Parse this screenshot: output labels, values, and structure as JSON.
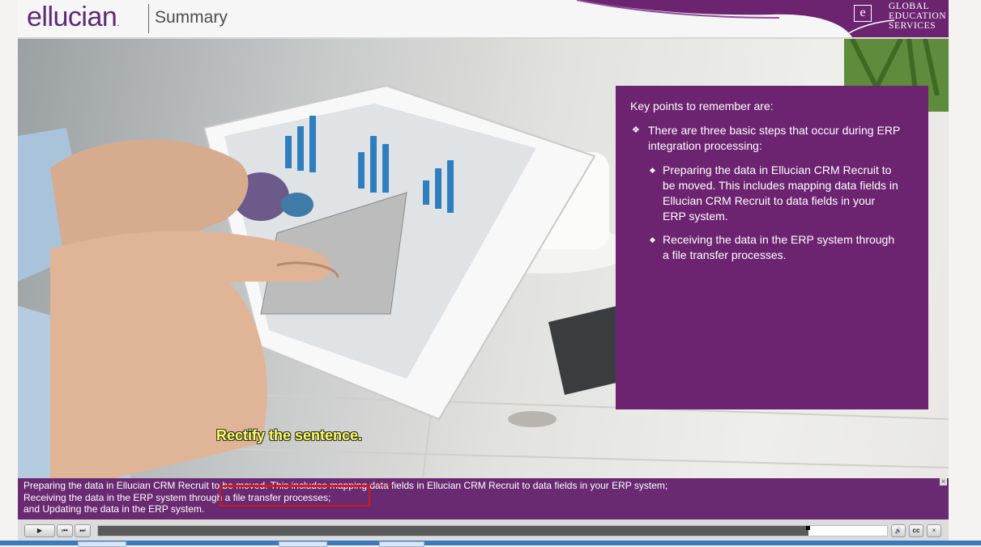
{
  "header": {
    "logo": "ellucian",
    "logo_mark": ".",
    "title": "Summary",
    "badge_letter": "e",
    "badge_lines": [
      "GLOBAL",
      "EDUCATION",
      "SERVICES"
    ]
  },
  "panel": {
    "intro": "Key points to remember are:",
    "bullet": "There are three basic steps that occur during ERP integration processing:",
    "sub_bullets": [
      "Preparing the data in Ellucian CRM Recruit to be moved. This includes mapping data fields in Ellucian CRM Recruit to data fields in your ERP system.",
      "Receiving the data in the ERP system through a file transfer processes."
    ],
    "bullet_marker": "❖",
    "sub_marker": "◆"
  },
  "annotation": "Rectify the sentence.",
  "captions": {
    "lines": [
      "Preparing the data in Ellucian CRM Recruit to be moved. This includes mapping data fields in Ellucian CRM Recruit to data fields in your ERP system;",
      "Receiving the data in the ERP system through a file transfer processes;",
      "and Updating the data in the ERP system."
    ],
    "close": "×"
  },
  "player": {
    "play": "▶",
    "prev": "⏮",
    "next": "⏭",
    "volume": "🔊",
    "cc": "cc",
    "close": "×",
    "progress": 0.9
  },
  "colors": {
    "brand_purple": "#6c2470",
    "caption_purple": "#6a2a72",
    "annotation_yellow": "#fdfd5a",
    "highlight_red": "#d0191b"
  }
}
